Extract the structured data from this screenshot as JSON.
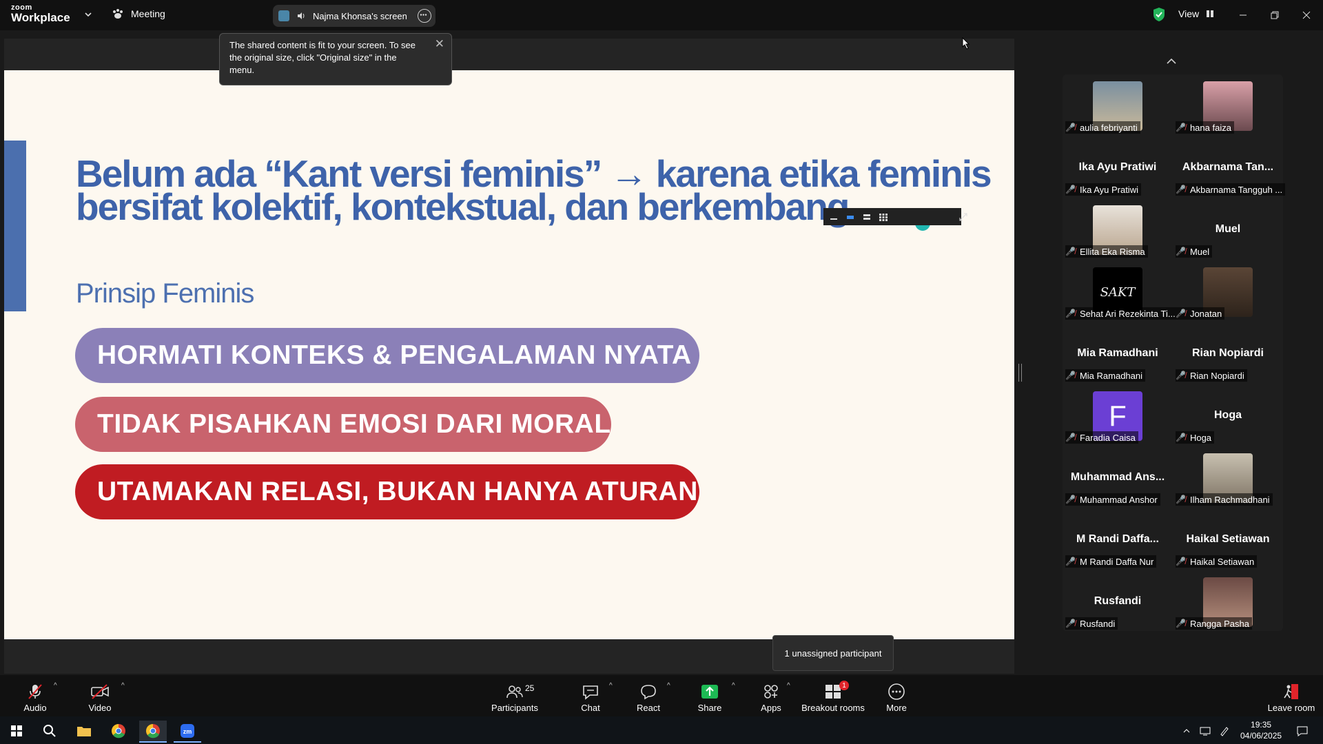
{
  "app": {
    "logo_small": "zoom",
    "logo_big": "Workplace",
    "meeting_label": "Meeting",
    "share_indicator": "Najma Khonsa's screen",
    "view_label": "View"
  },
  "toast": {
    "text": "The shared content is fit to your screen. To see the original size, click \"Original size\" in the menu."
  },
  "slide": {
    "title": "Belum ada “Kant versi feminis” → karena etika feminis bersifat kolektif, kontekstual, dan berkembang.",
    "subtitle": "Prinsip Feminis",
    "principles": [
      "HORMATI KONTEKS & PENGALAMAN NYATA",
      "TIDAK PISAHKAN EMOSI DARI MORAL",
      "UTAMAKAN RELASI, BUKAN HANYA ATURAN"
    ]
  },
  "gallery": {
    "participants": [
      {
        "label": "aulia febriyanti",
        "display": ""
      },
      {
        "label": "hana faiza",
        "display": ""
      },
      {
        "label": "Ika Ayu Pratiwi",
        "display": "Ika Ayu Pratiwi"
      },
      {
        "label": "Akbarnama Tangguh ...",
        "display": "Akbarnama Tan..."
      },
      {
        "label": "Ellita Eka Risma",
        "display": ""
      },
      {
        "label": "Muel",
        "display": "Muel"
      },
      {
        "label": "Sehat Ari Rezekinta Ti...",
        "display": "SAKT"
      },
      {
        "label": "Jonatan",
        "display": ""
      },
      {
        "label": "Mia Ramadhani",
        "display": "Mia Ramadhani"
      },
      {
        "label": "Rian Nopiardi",
        "display": "Rian Nopiardi"
      },
      {
        "label": "Faradia Caisa",
        "display": "F"
      },
      {
        "label": "Hoga",
        "display": "Hoga"
      },
      {
        "label": "Muhammad Anshor",
        "display": "Muhammad Ans..."
      },
      {
        "label": "Ilham Rachmadhani",
        "display": ""
      },
      {
        "label": "M Randi Daffa Nur",
        "display": "M Randi Daffa..."
      },
      {
        "label": "Haikal Setiawan",
        "display": "Haikal Setiawan"
      },
      {
        "label": "Rusfandi",
        "display": "Rusfandi"
      },
      {
        "label": "Rangga Pasha",
        "display": ""
      }
    ]
  },
  "tooltip": "1 unassigned participant",
  "toolbar": {
    "audio": "Audio",
    "video": "Video",
    "participants": "Participants",
    "participants_count": "25",
    "chat": "Chat",
    "react": "React",
    "share": "Share",
    "apps": "Apps",
    "breakout": "Breakout rooms",
    "breakout_badge": "1",
    "more": "More",
    "leave": "Leave room"
  },
  "taskbar": {
    "time": "19:35",
    "date": "04/06/2025"
  },
  "colors": {
    "slide_bg": "#fdf8f0",
    "title_blue": "#3e63aa",
    "pill_purple": "#8b80b8",
    "pill_pink": "#c9636d",
    "pill_red": "#c01c22",
    "share_green": "#1db954",
    "muted_red": "#e0484b"
  }
}
